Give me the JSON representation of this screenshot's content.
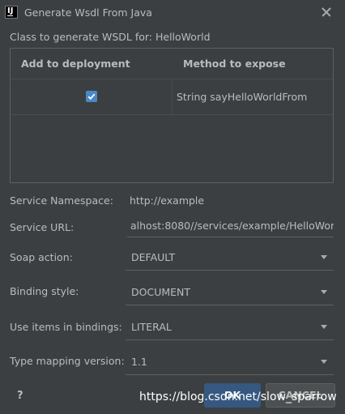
{
  "window": {
    "title": "Generate Wsdl From Java"
  },
  "class_label": "Class to generate WSDL for: HelloWorld",
  "table": {
    "headers": [
      "Add to deployment",
      "Method to expose"
    ],
    "rows": [
      {
        "checked": true,
        "method": "String sayHelloWorldFrom"
      }
    ]
  },
  "form": {
    "namespace_label": "Service Namespace:",
    "namespace_value": "http://example",
    "url_label": "Service URL:",
    "url_value": "alhost:8080//services/example/HelloWorld",
    "soap_label": "Soap action:",
    "soap_value": "DEFAULT",
    "binding_label": "Binding style:",
    "binding_value": "DOCUMENT",
    "use_label": "Use items in bindings:",
    "use_value": "LITERAL",
    "type_label": "Type mapping version:",
    "type_value": "1.1"
  },
  "footer": {
    "help": "?",
    "ok": "OK",
    "cancel": "CANCEL"
  },
  "watermark": "https://blog.csdn.net/slow_sparrow",
  "colors": {
    "background": "#3c3f41",
    "accent": "#4a88c7",
    "ok_button": "#365880"
  }
}
